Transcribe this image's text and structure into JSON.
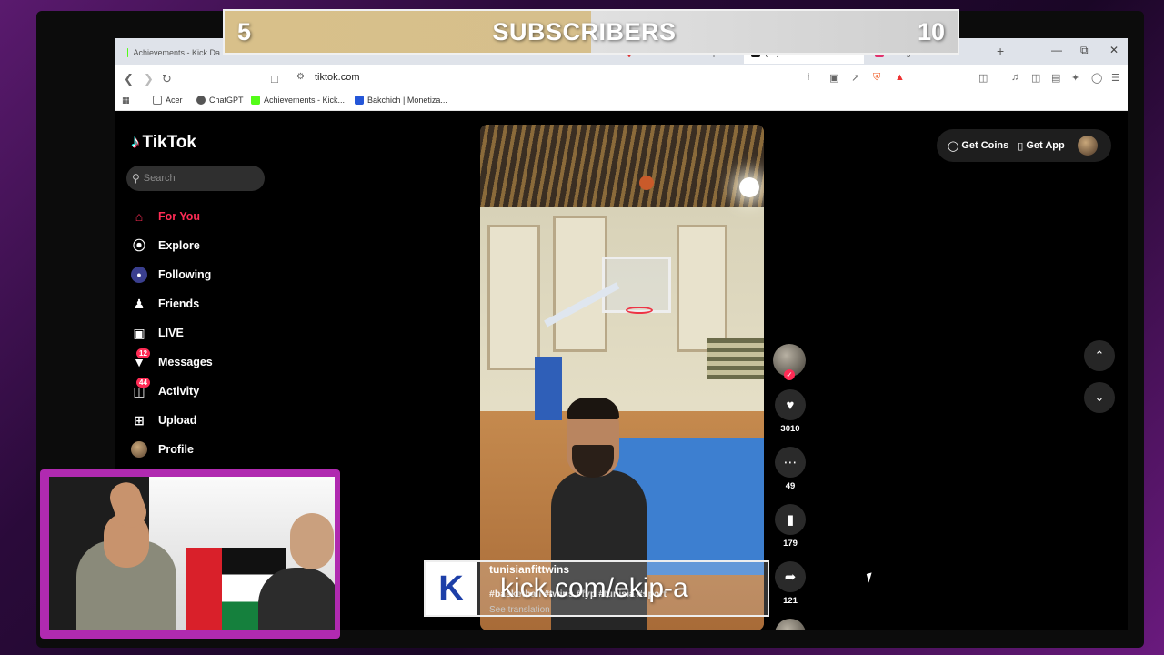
{
  "browser": {
    "tabs": [
      {
        "label": "Achievements - Kick Da",
        "color": "#53fc18"
      },
      {
        "label": "tball",
        "color": "#888888"
      },
      {
        "label": "GeoGuessr - Let's explore",
        "color": "#d33"
      },
      {
        "label": "(56)TikTok - Make",
        "color": "#111111",
        "close": "×"
      },
      {
        "label": "Instagram",
        "color": "#e1306c"
      }
    ],
    "new_tab": "+",
    "url": "tiktok.com",
    "bookmarks": [
      {
        "label": "Acer",
        "color": "#777"
      },
      {
        "label": "ChatGPT",
        "color": "#555"
      },
      {
        "label": "Achievements - Kick...",
        "color": "#53fc18"
      },
      {
        "label": "Bakchich | Monetiza...",
        "color": "#2456d8"
      }
    ]
  },
  "tiktok": {
    "logo": "TikTok",
    "search_placeholder": "Search",
    "nav": [
      {
        "label": "For You",
        "icon": "home-icon",
        "active": true
      },
      {
        "label": "Explore",
        "icon": "compass-icon"
      },
      {
        "label": "Following",
        "icon": "following-icon"
      },
      {
        "label": "Friends",
        "icon": "friends-icon"
      },
      {
        "label": "LIVE",
        "icon": "live-icon"
      },
      {
        "label": "Messages",
        "icon": "messages-icon",
        "badge": "12"
      },
      {
        "label": "Activity",
        "icon": "activity-icon",
        "badge": "44"
      },
      {
        "label": "Upload",
        "icon": "upload-icon"
      },
      {
        "label": "Profile",
        "icon": "profile-avatar"
      }
    ],
    "get_coins": "Get Coins",
    "get_app": "Get App",
    "video": {
      "username": "tunisianfittwins",
      "description": "#basketball #twins #fyp #tunisia #sport",
      "see_translation": "See translation"
    },
    "actions": {
      "likes": "3010",
      "comments": "49",
      "saves": "179",
      "shares": "121"
    }
  },
  "overlay": {
    "sub_current": "5",
    "sub_label": "SUBSCRIBERS",
    "sub_goal": "10",
    "kick_url": "kick.com/ekip-a"
  }
}
